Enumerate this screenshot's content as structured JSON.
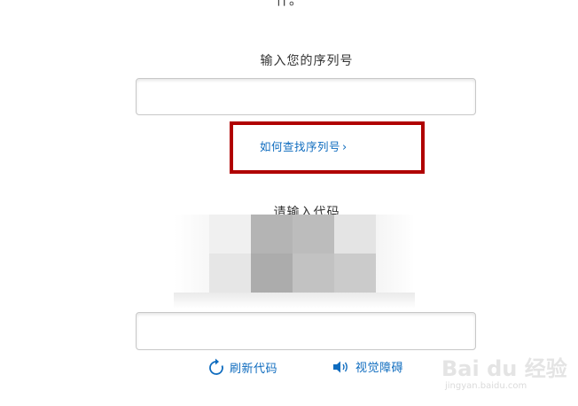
{
  "top_fragment": "什。",
  "serial": {
    "label": "输入您的序列号",
    "value": "",
    "placeholder": ""
  },
  "help_link": {
    "label": "如何查找序列号",
    "chevron": "›",
    "highlight_color": "#b00000"
  },
  "code": {
    "label": "请输入代码",
    "value": "",
    "placeholder": ""
  },
  "captcha_tiles": [
    "#f0f0f0",
    "#b4b4b4",
    "#bcbcbc",
    "#e4e4e4",
    "#e6e6e6",
    "#acacac",
    "#c2c2c2",
    "#cbcbcb"
  ],
  "actions": {
    "refresh_label": "刷新代码",
    "refresh_icon": "refresh-icon",
    "audio_label": "视觉障碍",
    "audio_icon": "speaker-icon"
  },
  "watermark": {
    "brand": "Bai du 经验",
    "url": "jingyan.baidu.com"
  },
  "colors": {
    "link": "#0f6cbf",
    "text": "#333333",
    "input_border": "#c8c8c8"
  }
}
